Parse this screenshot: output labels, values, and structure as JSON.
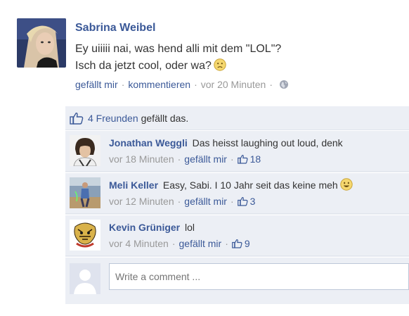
{
  "post": {
    "author": "Sabrina Weibel",
    "text_line1": "Ey uiiiii nai, was hend alli mit dem \"LOL\"?",
    "text_line2": "Isch da jetzt cool, oder wa?",
    "emoji": "sad-face",
    "like_label": "gefällt mir",
    "comment_label": "kommentieren",
    "time": "vor 20 Minuten",
    "sep": "·",
    "privacy_icon": "globe-icon"
  },
  "likes": {
    "count_label": "4 Freunden",
    "rest_label": "gefällt das."
  },
  "comments": [
    {
      "author": "Jonathan Weggli",
      "text": "Das heisst laughing out loud, denk",
      "time": "vor 18 Minuten",
      "like_label": "gefällt mir",
      "like_count": "18"
    },
    {
      "author": "Meli Keller",
      "text": "Easy, Sabi. I 10 Jahr seit das keine meh",
      "emoji": "smile-face",
      "time": "vor 12 Minuten",
      "like_label": "gefällt mir",
      "like_count": "3"
    },
    {
      "author": "Kevin Grüniger",
      "text": "lol",
      "time": "vor 4 Minuten",
      "like_label": "gefällt mir",
      "like_count": "9"
    }
  ],
  "compose": {
    "placeholder": "Write a comment ..."
  },
  "colors": {
    "link": "#3b5998",
    "muted": "#999999",
    "panel": "#eceff5"
  }
}
